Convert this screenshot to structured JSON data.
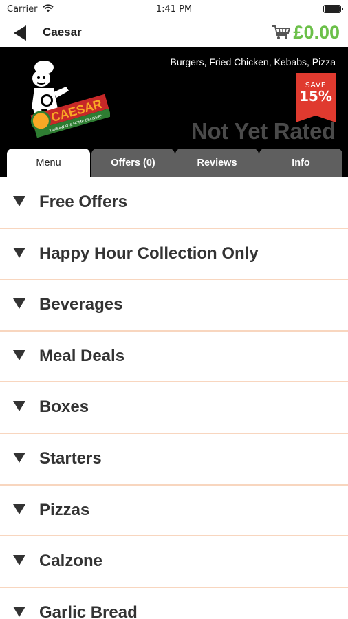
{
  "status_bar": {
    "carrier": "Carrier",
    "time": "1:41 PM",
    "battery_level": 1.0
  },
  "nav": {
    "title": "Caesar",
    "back_icon": "back-arrow-icon",
    "cart_icon": "shopping-cart-icon",
    "cart_total": "£0.00",
    "accent_color": "#6cc04a"
  },
  "hero": {
    "cuisines": "Burgers, Fried Chicken, Kebabs, Pizza",
    "save_label": "SAVE",
    "save_value": "15%",
    "rating_text": "Not Yet Rated",
    "logo": {
      "brand": "CAESAR",
      "tagline": "TAKEAWAY & HOME DELIVERY"
    },
    "badge_color": "#e03a2f"
  },
  "tabs": [
    {
      "label": "Menu",
      "active": true
    },
    {
      "label": "Offers (0)",
      "active": false
    },
    {
      "label": "Reviews",
      "active": false
    },
    {
      "label": "Info",
      "active": false
    }
  ],
  "menu": {
    "expand_icon": "triangle-down-icon",
    "categories": [
      "Free Offers",
      "Happy Hour Collection Only",
      "Beverages",
      "Meal Deals",
      "Boxes",
      "Starters",
      "Pizzas",
      "Calzone",
      "Garlic Bread"
    ],
    "divider_color": "#f8d6bf"
  }
}
